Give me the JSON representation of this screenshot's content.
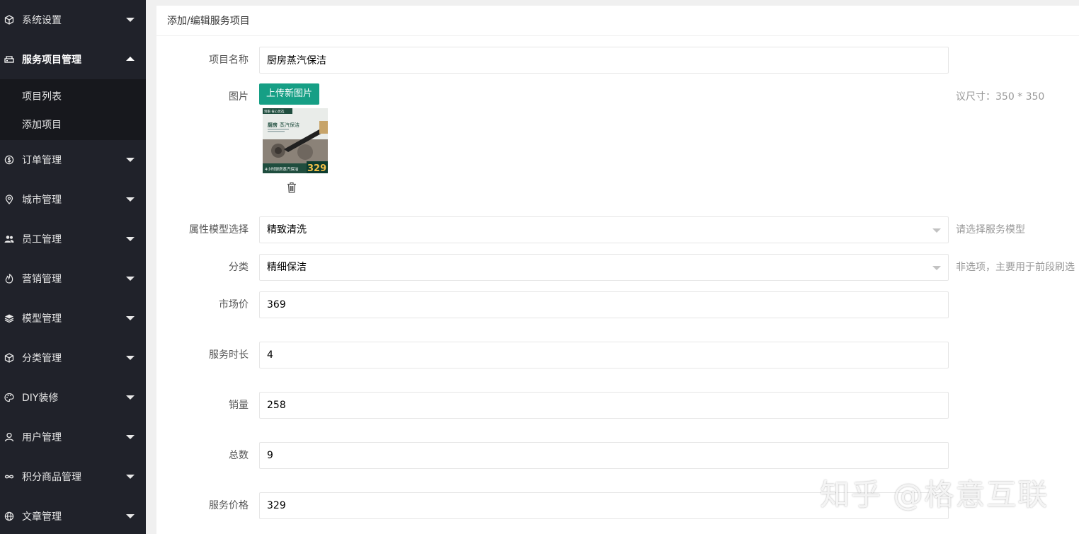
{
  "sidebar": {
    "items": [
      {
        "label": "系统设置",
        "icon": "cube-icon",
        "open": false
      },
      {
        "label": "服务项目管理",
        "icon": "server-icon",
        "open": true,
        "children": [
          {
            "label": "项目列表"
          },
          {
            "label": "添加项目"
          }
        ]
      },
      {
        "label": "订单管理",
        "icon": "dollar-circle-icon",
        "open": false
      },
      {
        "label": "城市管理",
        "icon": "location-pin-icon",
        "open": false
      },
      {
        "label": "员工管理",
        "icon": "users-icon",
        "open": false
      },
      {
        "label": "营销管理",
        "icon": "fire-icon",
        "open": false
      },
      {
        "label": "模型管理",
        "icon": "layers-icon",
        "open": false
      },
      {
        "label": "分类管理",
        "icon": "cube-icon",
        "open": false
      },
      {
        "label": "DIY装修",
        "icon": "palette-icon",
        "open": false
      },
      {
        "label": "用户管理",
        "icon": "user-icon",
        "open": false
      },
      {
        "label": "积分商品管理",
        "icon": "infinity-icon",
        "open": false
      },
      {
        "label": "文章管理",
        "icon": "globe-icon",
        "open": false
      }
    ]
  },
  "panel": {
    "title": "添加/编辑服务项目"
  },
  "form": {
    "name": {
      "label": "项目名称",
      "value": "厨房蒸汽保洁"
    },
    "image": {
      "label": "图片",
      "upload_label": "上传新图片",
      "hint": "议尺寸：350 * 350"
    },
    "thumb": {
      "badge": "到家·省心优选",
      "title": "厨房",
      "title2": "蒸汽保洁",
      "bottom": "4小时厨房蒸汽保洁",
      "price": "329"
    },
    "model": {
      "label": "属性模型选择",
      "value": "精致清洗",
      "hint": "请选择服务模型"
    },
    "category": {
      "label": "分类",
      "value": "精细保洁",
      "hint": "非选项，主要用于前段刷选"
    },
    "market_price": {
      "label": "市场价",
      "value": "369"
    },
    "duration": {
      "label": "服务时长",
      "value": "4"
    },
    "sales": {
      "label": "销量",
      "value": "258"
    },
    "total": {
      "label": "总数",
      "value": "9"
    },
    "price": {
      "label": "服务价格",
      "value": "329"
    }
  },
  "watermark": "知乎 @格意互联",
  "colors": {
    "sidebar_bg": "#20222a",
    "submenu_bg": "#17181d",
    "accent": "#169f85"
  }
}
